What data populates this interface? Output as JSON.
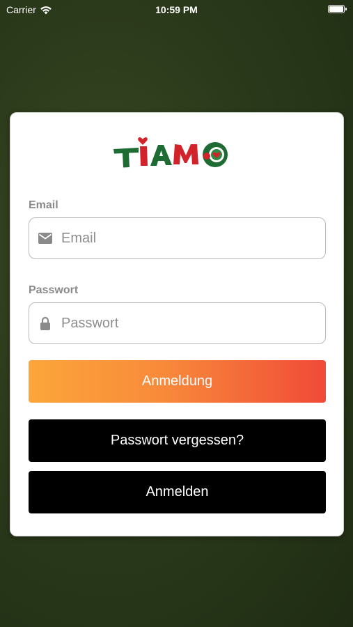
{
  "status_bar": {
    "carrier": "Carrier",
    "time": "10:59 PM"
  },
  "logo": {
    "text": "TIAMO",
    "colors": {
      "green": "#1f6b34",
      "red": "#d3232a",
      "heart": "#d3232a"
    }
  },
  "form": {
    "email": {
      "label": "Email",
      "placeholder": "Email",
      "icon": "mail-icon"
    },
    "password": {
      "label": "Passwort",
      "placeholder": "Passwort",
      "icon": "lock-icon"
    }
  },
  "buttons": {
    "login": "Anmeldung",
    "forgot": "Passwort vergessen?",
    "signup": "Anmelden"
  },
  "colors": {
    "gradient_start": "#fca63a",
    "gradient_end": "#f04a38",
    "background": "#2b3a1b"
  }
}
